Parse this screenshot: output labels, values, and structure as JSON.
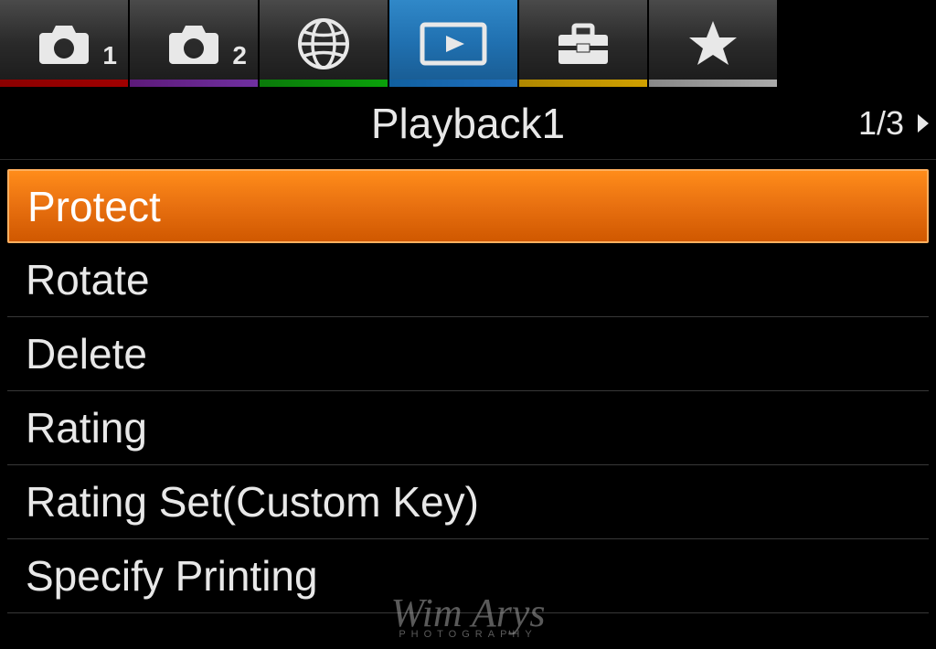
{
  "tabs": {
    "camera1_badge": "1",
    "camera2_badge": "2"
  },
  "header": {
    "title": "Playback1",
    "page_indicator": "1/3"
  },
  "menu": {
    "items": [
      {
        "label": "Protect",
        "selected": true
      },
      {
        "label": "Rotate",
        "selected": false
      },
      {
        "label": "Delete",
        "selected": false
      },
      {
        "label": "Rating",
        "selected": false
      },
      {
        "label": "Rating Set(Custom Key)",
        "selected": false
      },
      {
        "label": "Specify Printing",
        "selected": false
      }
    ]
  },
  "watermark": {
    "name": "Wim Arys",
    "subtitle": "PHOTOGRAPHY"
  }
}
